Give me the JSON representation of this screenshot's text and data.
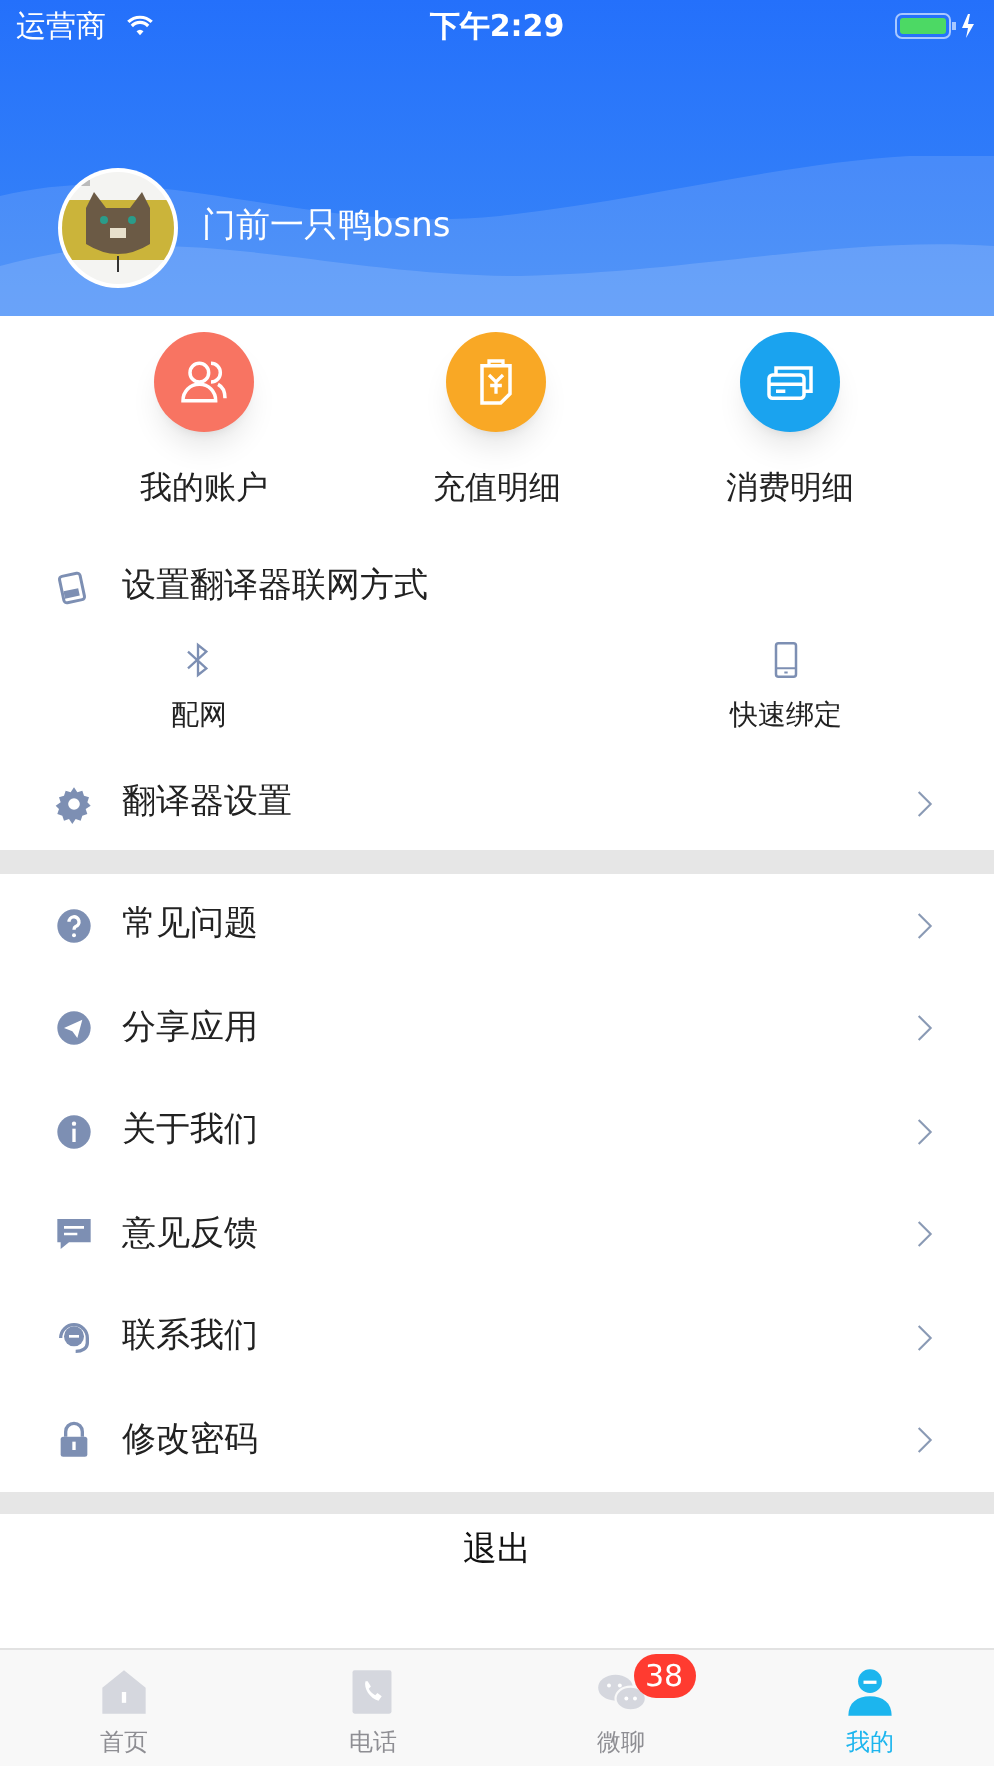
{
  "status_bar": {
    "carrier": "运营商",
    "time": "下午2:29"
  },
  "profile": {
    "name": "门前一只鸭bsns"
  },
  "quick_actions": [
    {
      "label": "我的账户",
      "kind": "account",
      "color": "#f87462"
    },
    {
      "label": "充值明细",
      "kind": "recharge",
      "color": "#f9a825"
    },
    {
      "label": "消费明细",
      "kind": "spending",
      "color": "#1aa3ef"
    }
  ],
  "network_setup": {
    "title": "设置翻译器联网方式",
    "options": [
      {
        "label": "配网",
        "kind": "bluetooth"
      },
      {
        "label": "快速绑定",
        "kind": "phone"
      }
    ]
  },
  "translator_settings": {
    "label": "翻译器设置"
  },
  "menu": [
    {
      "label": "常见问题",
      "kind": "question"
    },
    {
      "label": "分享应用",
      "kind": "share"
    },
    {
      "label": "关于我们",
      "kind": "info"
    },
    {
      "label": "意见反馈",
      "kind": "feedback"
    },
    {
      "label": "联系我们",
      "kind": "support"
    },
    {
      "label": "修改密码",
      "kind": "lock"
    }
  ],
  "logout": {
    "label": "退出"
  },
  "tab_bar": [
    {
      "label": "首页",
      "kind": "home",
      "selected": false
    },
    {
      "label": "电话",
      "kind": "phone",
      "selected": false
    },
    {
      "label": "微聊",
      "kind": "chat",
      "selected": false,
      "badge": "38"
    },
    {
      "label": "我的",
      "kind": "me",
      "selected": true
    }
  ]
}
